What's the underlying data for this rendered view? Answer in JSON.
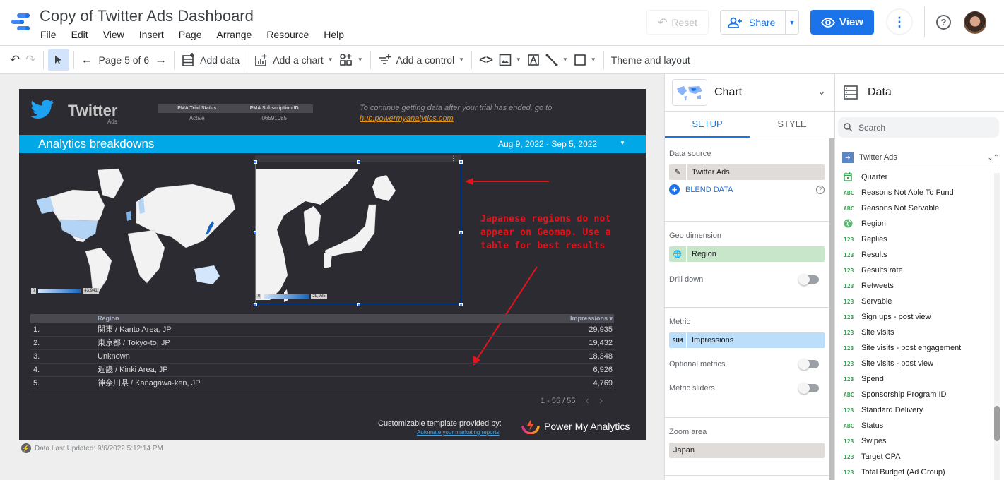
{
  "app": {
    "title": "Copy of Twitter Ads Dashboard",
    "menu": [
      "File",
      "Edit",
      "View",
      "Insert",
      "Page",
      "Arrange",
      "Resource",
      "Help"
    ],
    "reset_label": "Reset",
    "share_label": "Share",
    "view_label": "View"
  },
  "toolbar": {
    "page_indicator": "Page 5 of 6",
    "add_data": "Add data",
    "add_chart": "Add a chart",
    "add_control": "Add a control",
    "theme_layout": "Theme and layout"
  },
  "report": {
    "brand": "Twitter",
    "brand_sub": "Ads",
    "pma_headers": [
      "PMA Trial Status",
      "PMA Subscription ID"
    ],
    "pma_values": [
      "Active",
      "06591085"
    ],
    "trial_note": "To continue getting data after your trial has ended, go to",
    "trial_link": "hub.powermyanalytics.com",
    "section_title": "Analytics breakdowns",
    "date_range": "Aug 9, 2022 - Sep 5, 2022",
    "annotation": "Japanese regions do not appear on Geomap. Use a table for best results",
    "world_legend": {
      "min": "0",
      "max": "43,941"
    },
    "japan_legend": {
      "min": "0",
      "max": "29,935"
    },
    "table": {
      "headers": {
        "region": "Region",
        "impressions": "Impressions ▾"
      },
      "rows": [
        {
          "idx": "1.",
          "region": "関東 / Kanto Area, JP",
          "impressions": "29,935"
        },
        {
          "idx": "2.",
          "region": "東京都 / Tokyo-to, JP",
          "impressions": "19,432"
        },
        {
          "idx": "3.",
          "region": "Unknown",
          "impressions": "18,348"
        },
        {
          "idx": "4.",
          "region": "近畿 / Kinki Area, JP",
          "impressions": "6,926"
        },
        {
          "idx": "5.",
          "region": "神奈川県 / Kanagawa-ken, JP",
          "impressions": "4,769"
        }
      ],
      "pagination": "1 - 55 / 55"
    },
    "footer_text": "Customizable template provided by:",
    "footer_link": "Automate your marketing reports",
    "footer_brand": "Power My Analytics",
    "last_updated": "Data Last Updated: 9/6/2022 5:12:14 PM"
  },
  "properties": {
    "title": "Chart",
    "tabs": [
      "SETUP",
      "STYLE"
    ],
    "data_source_label": "Data source",
    "data_source": "Twitter Ads",
    "blend_label": "BLEND DATA",
    "geo_dimension_label": "Geo dimension",
    "geo_dimension": "Region",
    "drill_down_label": "Drill down",
    "metric_label": "Metric",
    "metric_agg": "SUM",
    "metric": "Impressions",
    "optional_metrics_label": "Optional metrics",
    "metric_sliders_label": "Metric sliders",
    "zoom_area_label": "Zoom area",
    "zoom_area": "Japan"
  },
  "data_panel": {
    "title": "Data",
    "search_placeholder": "Search",
    "source": "Twitter Ads",
    "fields": [
      {
        "type": "date",
        "name": "Quarter"
      },
      {
        "type": "ABC",
        "name": "Reasons Not Able To Fund"
      },
      {
        "type": "ABC",
        "name": "Reasons Not Servable"
      },
      {
        "type": "geo",
        "name": "Region"
      },
      {
        "type": "123",
        "name": "Replies"
      },
      {
        "type": "123",
        "name": "Results"
      },
      {
        "type": "123",
        "name": "Results rate"
      },
      {
        "type": "123",
        "name": "Retweets"
      },
      {
        "type": "123",
        "name": "Servable"
      },
      {
        "type": "123",
        "name": "Sign ups - post view"
      },
      {
        "type": "123",
        "name": "Site visits"
      },
      {
        "type": "123",
        "name": "Site visits - post engagement"
      },
      {
        "type": "123",
        "name": "Site visits - post view"
      },
      {
        "type": "123",
        "name": "Spend"
      },
      {
        "type": "ABC",
        "name": "Sponsorship Program ID"
      },
      {
        "type": "123",
        "name": "Standard Delivery"
      },
      {
        "type": "ABC",
        "name": "Status"
      },
      {
        "type": "123",
        "name": "Swipes"
      },
      {
        "type": "123",
        "name": "Target CPA"
      },
      {
        "type": "123",
        "name": "Total Budget (Ad Group)"
      }
    ]
  },
  "colors": {
    "accent": "#1a73e8",
    "banner": "#01a8e8",
    "report_bg": "#2c2b31",
    "annotation": "#e3141b",
    "trial_link": "#e8930d"
  }
}
